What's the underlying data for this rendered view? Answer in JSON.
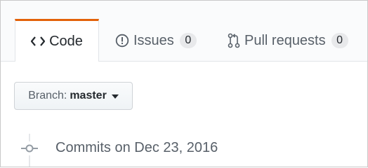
{
  "tabs": [
    {
      "label": "Code",
      "icon": "code-icon",
      "selected": true
    },
    {
      "label": "Issues",
      "icon": "issue-opened-icon",
      "count": "0"
    },
    {
      "label": "Pull requests",
      "icon": "git-pull-request-icon",
      "count": "0"
    }
  ],
  "branch": {
    "prefix": "Branch:",
    "name": "master",
    "icon": "triangle-down-icon"
  },
  "commits": {
    "heading": "Commits on Dec 23, 2016",
    "icon": "git-commit-icon"
  },
  "colors": {
    "selected_tab_accent": "#e36209",
    "tab_text": "#586069",
    "text": "#24292e"
  }
}
